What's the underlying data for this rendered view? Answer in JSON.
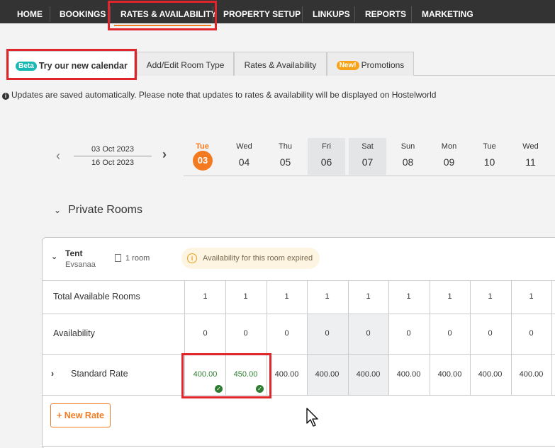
{
  "nav": {
    "items": [
      "HOME",
      "BOOKINGS",
      "RATES & AVAILABILITY",
      "PROPERTY SETUP",
      "LINKUPS",
      "REPORTS",
      "MARKETING"
    ]
  },
  "tabs": {
    "calendar": {
      "badge": "Beta",
      "label": "Try our new calendar"
    },
    "room_type": "Add/Edit Room Type",
    "rates": "Rates & Availability",
    "promotions": {
      "badge": "New!",
      "label": "Promotions"
    }
  },
  "notice": "Updates are saved automatically. Please note that updates to rates & availability will be displayed on Hostelworld",
  "range": {
    "start": "03 Oct 2023",
    "end": "16 Oct 2023"
  },
  "days": [
    {
      "name": "Tue",
      "num": "03",
      "today": true,
      "weekend": false
    },
    {
      "name": "Wed",
      "num": "04",
      "today": false,
      "weekend": false
    },
    {
      "name": "Thu",
      "num": "05",
      "today": false,
      "weekend": false
    },
    {
      "name": "Fri",
      "num": "06",
      "today": false,
      "weekend": true
    },
    {
      "name": "Sat",
      "num": "07",
      "today": false,
      "weekend": true
    },
    {
      "name": "Sun",
      "num": "08",
      "today": false,
      "weekend": false
    },
    {
      "name": "Mon",
      "num": "09",
      "today": false,
      "weekend": false
    },
    {
      "name": "Tue",
      "num": "10",
      "today": false,
      "weekend": false
    },
    {
      "name": "Wed",
      "num": "11",
      "today": false,
      "weekend": false
    }
  ],
  "section": {
    "title": "Private Rooms"
  },
  "room": {
    "name": "Tent",
    "property": "Evsanaa",
    "count": "1 room",
    "expired": "Availability for this room expired"
  },
  "rows": {
    "total_label": "Total Available Rooms",
    "total_values": [
      "1",
      "1",
      "1",
      "1",
      "1",
      "1",
      "1",
      "1",
      "1"
    ],
    "avail_label": "Availability",
    "avail_values": [
      "0",
      "0",
      "0",
      "0",
      "0",
      "0",
      "0",
      "0",
      "0"
    ],
    "rate_label": "Standard Rate",
    "rate_values": [
      "400.00",
      "450.00",
      "400.00",
      "400.00",
      "400.00",
      "400.00",
      "400.00",
      "400.00",
      "400.00"
    ]
  },
  "new_rate": "+ New Rate"
}
